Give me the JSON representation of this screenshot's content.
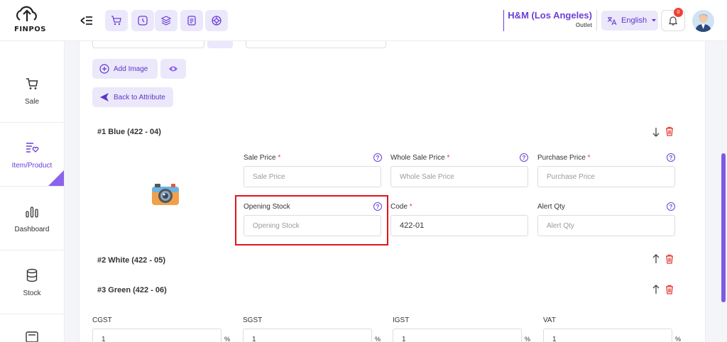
{
  "header": {
    "logo_text": "FINPOS",
    "store_name": "H&M (Los Angeles)",
    "store_type": "Outlet",
    "language": "English",
    "notification_count": "0"
  },
  "sidebar": {
    "items": [
      {
        "label": "Sale",
        "icon": "cart-icon"
      },
      {
        "label": "Item/Product",
        "icon": "product-list-icon"
      },
      {
        "label": "Dashboard",
        "icon": "bar-chart-icon"
      },
      {
        "label": "Stock",
        "icon": "database-icon"
      }
    ]
  },
  "actions": {
    "add_image": "Add Image",
    "back_to_attribute": "Back to Attribute"
  },
  "variants": [
    {
      "title": "#1 Blue (422 - 04)"
    },
    {
      "title": "#2 White (422 - 05)"
    },
    {
      "title": "#3 Green (422 - 06)"
    }
  ],
  "form": {
    "sale_price": {
      "label": "Sale Price",
      "placeholder": "Sale Price",
      "required": "*"
    },
    "wholesale_price": {
      "label": "Whole Sale Price",
      "placeholder": "Whole Sale Price",
      "required": "*"
    },
    "purchase_price": {
      "label": "Purchase Price",
      "placeholder": "Purchase Price",
      "required": "*"
    },
    "opening_stock": {
      "label": "Opening Stock",
      "placeholder": "Opening Stock"
    },
    "code": {
      "label": "Code",
      "value": "422-01",
      "required": "*"
    },
    "alert_qty": {
      "label": "Alert Qty",
      "placeholder": "Alert Qty"
    }
  },
  "taxes": [
    {
      "label": "CGST",
      "value": "1",
      "unit": "%"
    },
    {
      "label": "SGST",
      "value": "1",
      "unit": "%"
    },
    {
      "label": "IGST",
      "value": "1",
      "unit": "%"
    },
    {
      "label": "VAT",
      "value": "1",
      "unit": "%"
    }
  ],
  "colors": {
    "accent": "#6a3fd8",
    "accent_light": "#ece8fb",
    "danger": "#e53935"
  }
}
